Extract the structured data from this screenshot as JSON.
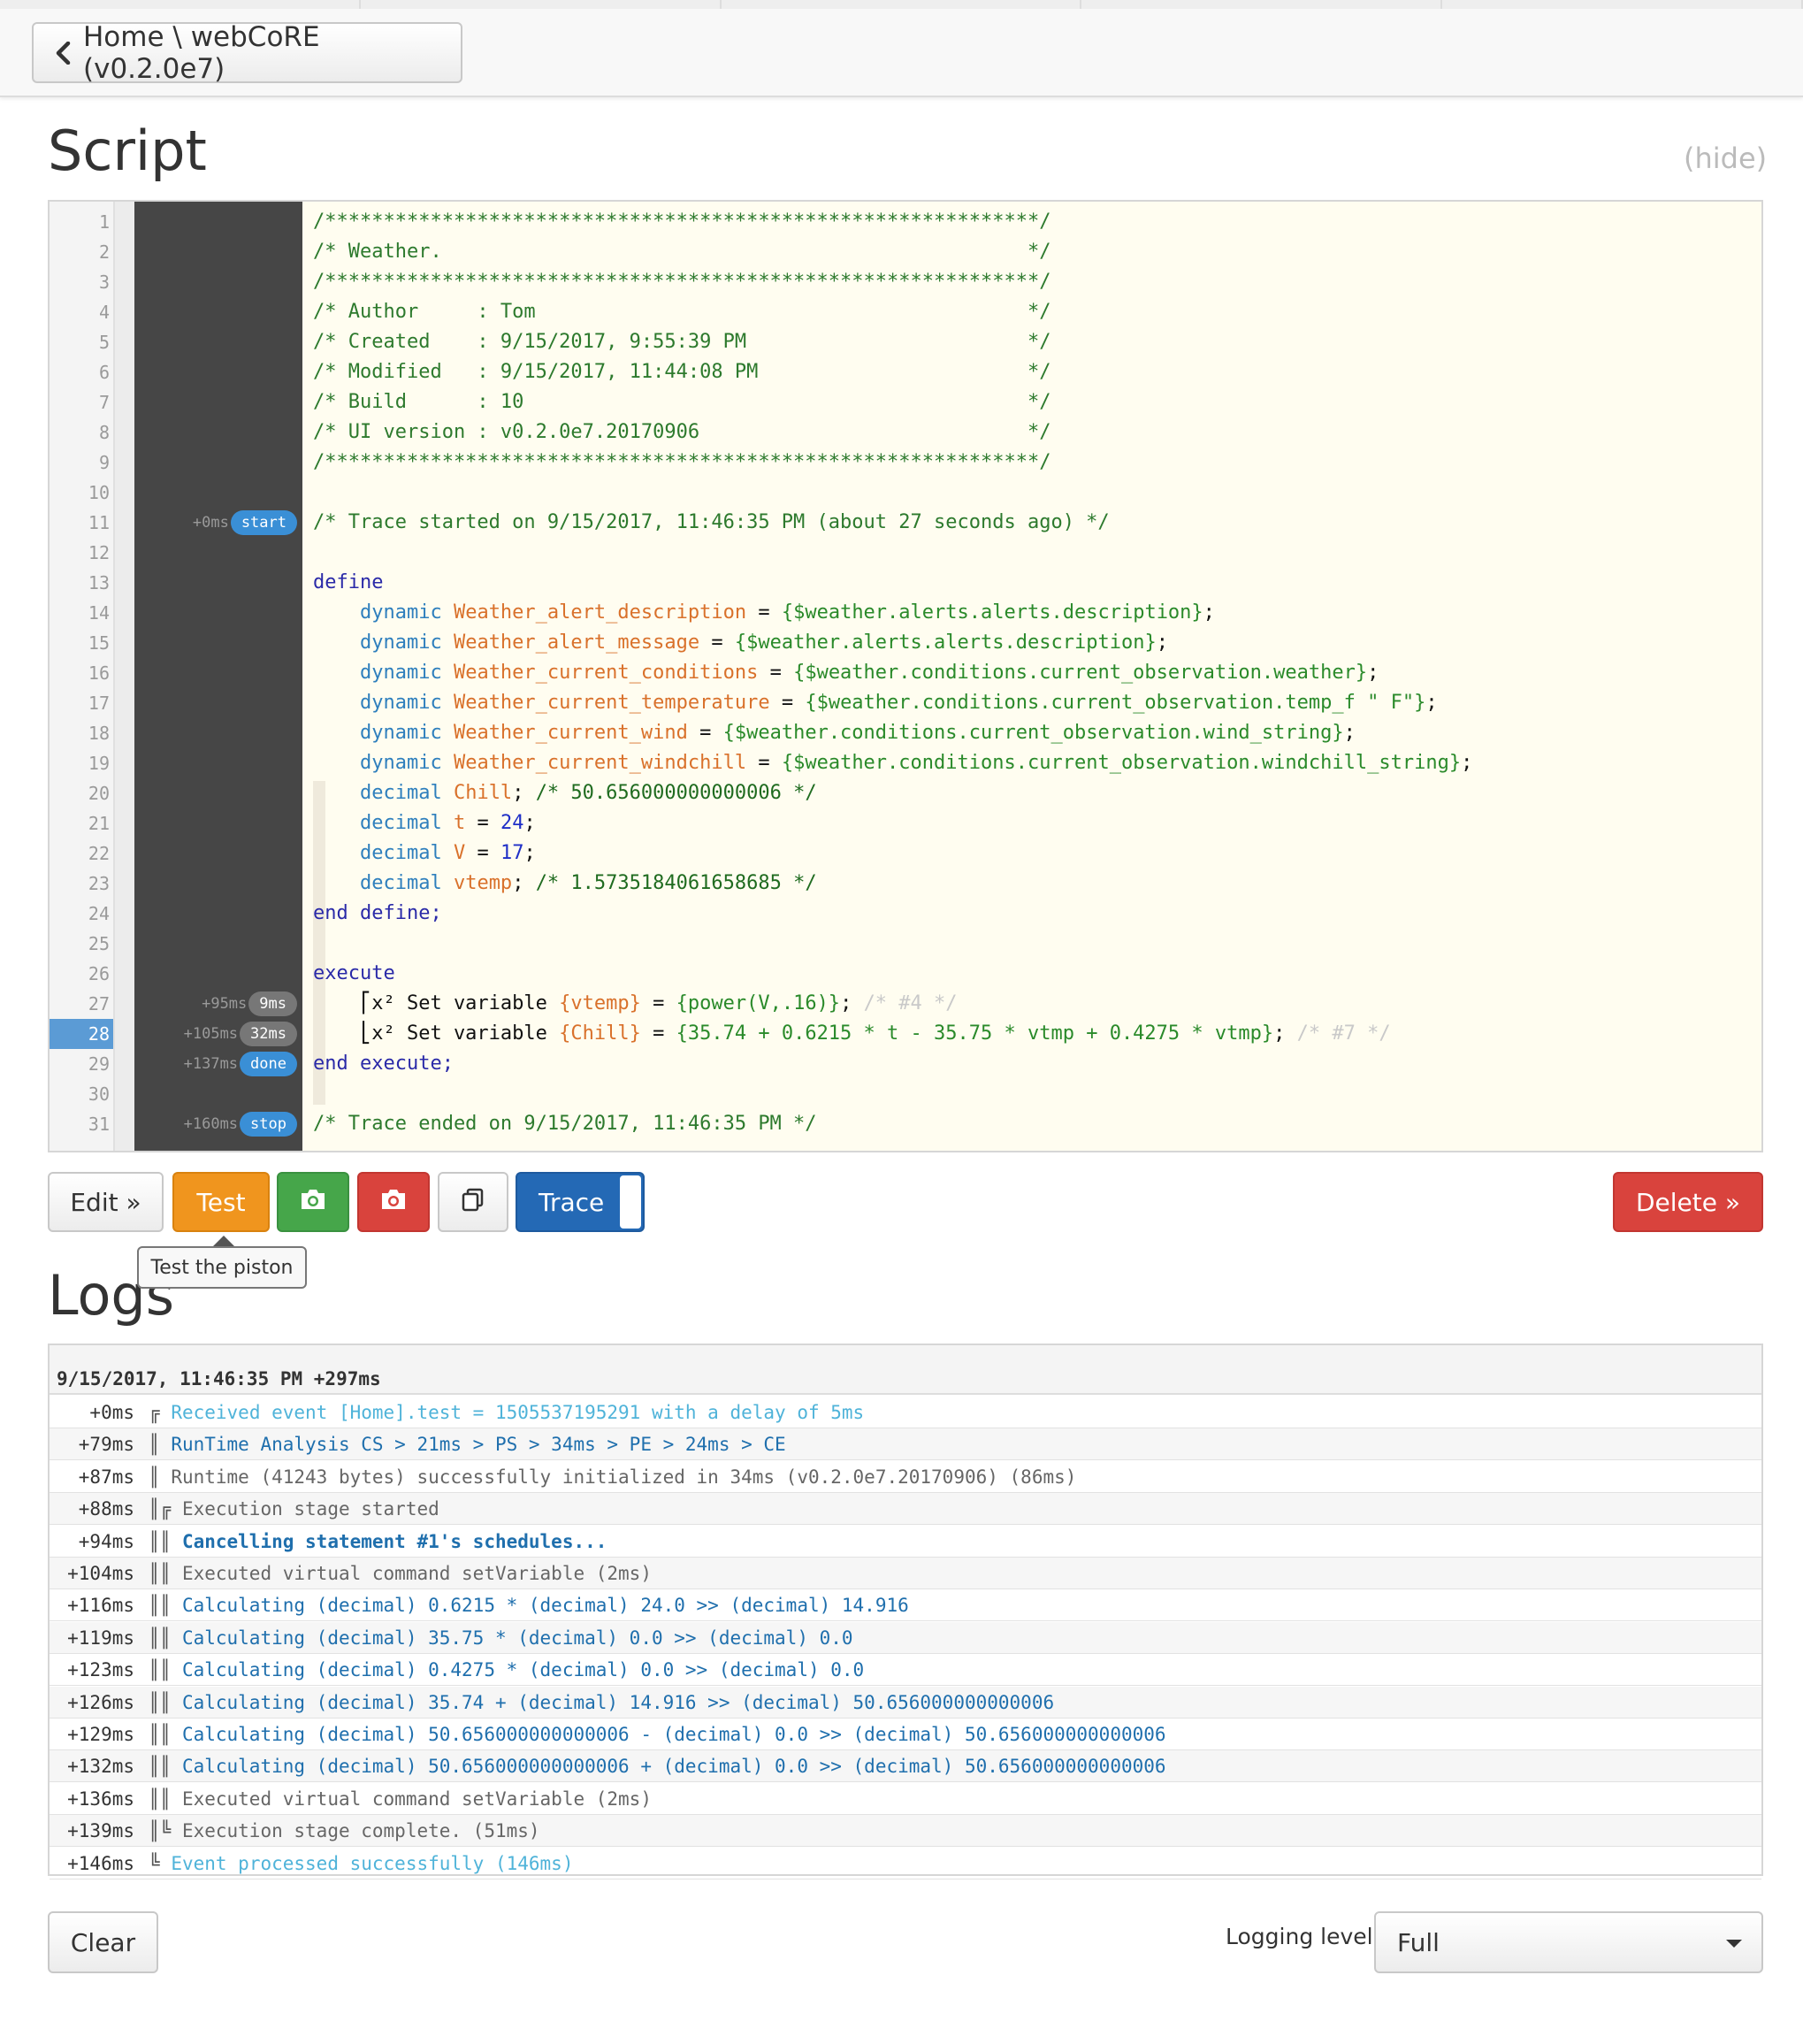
{
  "header": {
    "breadcrumb": "Home \\ webCoRE (v0.2.0e7)"
  },
  "script_section": {
    "title": "Script",
    "hide_link": "(hide)"
  },
  "script_lines": [
    {
      "n": "1",
      "t": "",
      "segs": [
        [
          "c-com",
          "/*************************************************************/"
        ]
      ]
    },
    {
      "n": "2",
      "t": "",
      "segs": [
        [
          "c-com",
          "/* Weather.                                                  */"
        ]
      ]
    },
    {
      "n": "3",
      "t": "",
      "segs": [
        [
          "c-com",
          "/*************************************************************/"
        ]
      ]
    },
    {
      "n": "4",
      "t": "",
      "segs": [
        [
          "c-com",
          "/* Author     : Tom                                          */"
        ]
      ]
    },
    {
      "n": "5",
      "t": "",
      "segs": [
        [
          "c-com",
          "/* Created    : 9/15/2017, 9:55:39 PM                        */"
        ]
      ]
    },
    {
      "n": "6",
      "t": "",
      "segs": [
        [
          "c-com",
          "/* Modified   : 9/15/2017, 11:44:08 PM                       */"
        ]
      ]
    },
    {
      "n": "7",
      "t": "",
      "segs": [
        [
          "c-com",
          "/* Build      : 10                                           */"
        ]
      ]
    },
    {
      "n": "8",
      "t": "",
      "segs": [
        [
          "c-com",
          "/* UI version : v0.2.0e7.20170906                            */"
        ]
      ]
    },
    {
      "n": "9",
      "t": "",
      "segs": [
        [
          "c-com",
          "/*************************************************************/"
        ]
      ]
    },
    {
      "n": "10",
      "t": "",
      "segs": []
    },
    {
      "n": "11",
      "time": "+0ms",
      "badge": "start",
      "badge_color": "blue",
      "segs": [
        [
          "c-com",
          "/* Trace started on 9/15/2017, 11:46:35 PM (about 27 seconds ago) */"
        ]
      ]
    },
    {
      "n": "12",
      "segs": []
    },
    {
      "n": "13",
      "segs": [
        [
          "c-key",
          "define"
        ]
      ]
    },
    {
      "n": "14",
      "segs": [
        [
          "",
          "    "
        ],
        [
          "c-typ",
          "dynamic "
        ],
        [
          "c-var",
          "Weather_alert_description"
        ],
        [
          "c-blk",
          " = "
        ],
        [
          "c-exp",
          "{$weather.alerts.alerts.description}"
        ],
        [
          "c-blk",
          ";"
        ]
      ]
    },
    {
      "n": "15",
      "segs": [
        [
          "",
          "    "
        ],
        [
          "c-typ",
          "dynamic "
        ],
        [
          "c-var",
          "Weather_alert_message"
        ],
        [
          "c-blk",
          " = "
        ],
        [
          "c-exp",
          "{$weather.alerts.alerts.description}"
        ],
        [
          "c-blk",
          ";"
        ]
      ]
    },
    {
      "n": "16",
      "segs": [
        [
          "",
          "    "
        ],
        [
          "c-typ",
          "dynamic "
        ],
        [
          "c-var",
          "Weather_current_conditions"
        ],
        [
          "c-blk",
          " = "
        ],
        [
          "c-exp",
          "{$weather.conditions.current_observation.weather}"
        ],
        [
          "c-blk",
          ";"
        ]
      ]
    },
    {
      "n": "17",
      "segs": [
        [
          "",
          "    "
        ],
        [
          "c-typ",
          "dynamic "
        ],
        [
          "c-var",
          "Weather_current_temperature"
        ],
        [
          "c-blk",
          " = "
        ],
        [
          "c-exp",
          "{$weather.conditions.current_observation.temp_f \" F\"}"
        ],
        [
          "c-blk",
          ";"
        ]
      ]
    },
    {
      "n": "18",
      "segs": [
        [
          "",
          "    "
        ],
        [
          "c-typ",
          "dynamic "
        ],
        [
          "c-var",
          "Weather_current_wind"
        ],
        [
          "c-blk",
          " = "
        ],
        [
          "c-exp",
          "{$weather.conditions.current_observation.wind_string}"
        ],
        [
          "c-blk",
          ";"
        ]
      ]
    },
    {
      "n": "19",
      "segs": [
        [
          "",
          "    "
        ],
        [
          "c-typ",
          "dynamic "
        ],
        [
          "c-var",
          "Weather_current_windchill"
        ],
        [
          "c-blk",
          " = "
        ],
        [
          "c-exp",
          "{$weather.conditions.current_observation.windchill_string}"
        ],
        [
          "c-blk",
          ";"
        ]
      ]
    },
    {
      "n": "20",
      "segs": [
        [
          "",
          "    "
        ],
        [
          "c-typ",
          "decimal "
        ],
        [
          "c-var",
          "Chill"
        ],
        [
          "c-blk",
          "; "
        ],
        [
          "c-com2",
          "/* 50.656000000000006 */"
        ]
      ]
    },
    {
      "n": "21",
      "segs": [
        [
          "",
          "    "
        ],
        [
          "c-typ",
          "decimal "
        ],
        [
          "c-var",
          "t"
        ],
        [
          "c-blk",
          " = "
        ],
        [
          "c-num",
          "24"
        ],
        [
          "c-blk",
          ";"
        ]
      ]
    },
    {
      "n": "22",
      "segs": [
        [
          "",
          "    "
        ],
        [
          "c-typ",
          "decimal "
        ],
        [
          "c-var",
          "V"
        ],
        [
          "c-blk",
          " = "
        ],
        [
          "c-num",
          "17"
        ],
        [
          "c-blk",
          ";"
        ]
      ]
    },
    {
      "n": "23",
      "segs": [
        [
          "",
          "    "
        ],
        [
          "c-typ",
          "decimal "
        ],
        [
          "c-var",
          "vtemp"
        ],
        [
          "c-blk",
          "; "
        ],
        [
          "c-com2",
          "/* 1.5735184061658685 */"
        ]
      ]
    },
    {
      "n": "24",
      "segs": [
        [
          "c-key",
          "end define;"
        ]
      ]
    },
    {
      "n": "25",
      "segs": []
    },
    {
      "n": "26",
      "segs": [
        [
          "c-key",
          "execute"
        ]
      ]
    },
    {
      "n": "27",
      "time": "+95ms",
      "badge": "9ms",
      "badge_color": "grey",
      "segs": [
        [
          "c-blk",
          "    ⎡x² Set variable "
        ],
        [
          "c-var",
          "{vtemp}"
        ],
        [
          "c-blk",
          " = "
        ],
        [
          "c-exp",
          "{power(V,.16)}"
        ],
        [
          "c-blk",
          "; "
        ],
        [
          "c-dim",
          "/* #4 */"
        ]
      ]
    },
    {
      "n": "28",
      "highlight": true,
      "time": "+105ms",
      "badge": "32ms",
      "badge_color": "grey",
      "segs": [
        [
          "c-blk",
          "    ⎣x² Set variable "
        ],
        [
          "c-var",
          "{Chill}"
        ],
        [
          "c-blk",
          " = "
        ],
        [
          "c-exp",
          "{35.74 + 0.6215 * t - 35.75 * vtmp + 0.4275 * vtmp}"
        ],
        [
          "c-blk",
          "; "
        ],
        [
          "c-dim",
          "/* #7 */"
        ]
      ]
    },
    {
      "n": "29",
      "time": "+137ms",
      "badge": "done",
      "badge_color": "blue",
      "segs": [
        [
          "c-key",
          "end execute;"
        ]
      ]
    },
    {
      "n": "30",
      "segs": []
    },
    {
      "n": "31",
      "time": "+160ms",
      "badge": "stop",
      "badge_color": "blue",
      "segs": [
        [
          "c-com",
          "/* Trace ended on 9/15/2017, 11:46:35 PM */"
        ]
      ]
    }
  ],
  "toolbar": {
    "edit_label": "Edit »",
    "test_label": "Test",
    "trace_label": "Trace",
    "delete_label": "Delete »",
    "tooltip": "Test the piston",
    "snapshot_green_icon": "camera-icon",
    "snapshot_red_icon": "camera-icon",
    "duplicate_icon": "copy-icon"
  },
  "logs_section": {
    "title": "Logs",
    "header": "9/15/2017, 11:46:35 PM +297ms",
    "rows": [
      {
        "time": "+0ms",
        "prefix": "╔",
        "text": "Received event [Home].test = 1505537195291 with a delay of 5ms",
        "cls": "l-cyan"
      },
      {
        "time": "+79ms",
        "prefix": "║",
        "text": "RunTime Analysis CS > 21ms > PS > 34ms > PE > 24ms > CE",
        "cls": "l-blue"
      },
      {
        "time": "+87ms",
        "prefix": "║",
        "text": "Runtime (41243 bytes) successfully initialized in 34ms (v0.2.0e7.20170906) (86ms)",
        "cls": "l-grey"
      },
      {
        "time": "+88ms",
        "prefix": "║╔",
        "text": "Execution stage started",
        "cls": "l-grey"
      },
      {
        "time": "+94ms",
        "prefix": "║║",
        "text": "Cancelling statement #1's schedules...",
        "cls": "l-blue",
        "bold": true
      },
      {
        "time": "+104ms",
        "prefix": "║║",
        "text": "Executed virtual command setVariable (2ms)",
        "cls": "l-grey"
      },
      {
        "time": "+116ms",
        "prefix": "║║",
        "text": "Calculating (decimal) 0.6215 * (decimal) 24.0 >> (decimal) 14.916",
        "cls": "l-blue"
      },
      {
        "time": "+119ms",
        "prefix": "║║",
        "text": "Calculating (decimal) 35.75 * (decimal) 0.0 >> (decimal) 0.0",
        "cls": "l-blue"
      },
      {
        "time": "+123ms",
        "prefix": "║║",
        "text": "Calculating (decimal) 0.4275 * (decimal) 0.0 >> (decimal) 0.0",
        "cls": "l-blue"
      },
      {
        "time": "+126ms",
        "prefix": "║║",
        "text": "Calculating (decimal) 35.74 + (decimal) 14.916 >> (decimal) 50.656000000000006",
        "cls": "l-blue"
      },
      {
        "time": "+129ms",
        "prefix": "║║",
        "text": "Calculating (decimal) 50.656000000000006 - (decimal) 0.0 >> (decimal) 50.656000000000006",
        "cls": "l-blue"
      },
      {
        "time": "+132ms",
        "prefix": "║║",
        "text": "Calculating (decimal) 50.656000000000006 + (decimal) 0.0 >> (decimal) 50.656000000000006",
        "cls": "l-blue"
      },
      {
        "time": "+136ms",
        "prefix": "║║",
        "text": "Executed virtual command setVariable (2ms)",
        "cls": "l-grey"
      },
      {
        "time": "+139ms",
        "prefix": "║╚",
        "text": "Execution stage complete. (51ms)",
        "cls": "l-grey"
      },
      {
        "time": "+146ms",
        "prefix": "╚",
        "text": "Event processed successfully (146ms)",
        "cls": "l-cyan"
      }
    ]
  },
  "footer": {
    "clear_label": "Clear",
    "logging_level_label": "Logging level",
    "logging_level_value": "Full"
  },
  "colors": {
    "test": "#f0951e",
    "snapshot_green": "#46a64a",
    "snapshot_red": "#d9433d",
    "trace": "#2469b5",
    "delete": "#d9433d",
    "badge_blue": "#3a8fd6",
    "line_highlight": "#5b9bd5"
  }
}
